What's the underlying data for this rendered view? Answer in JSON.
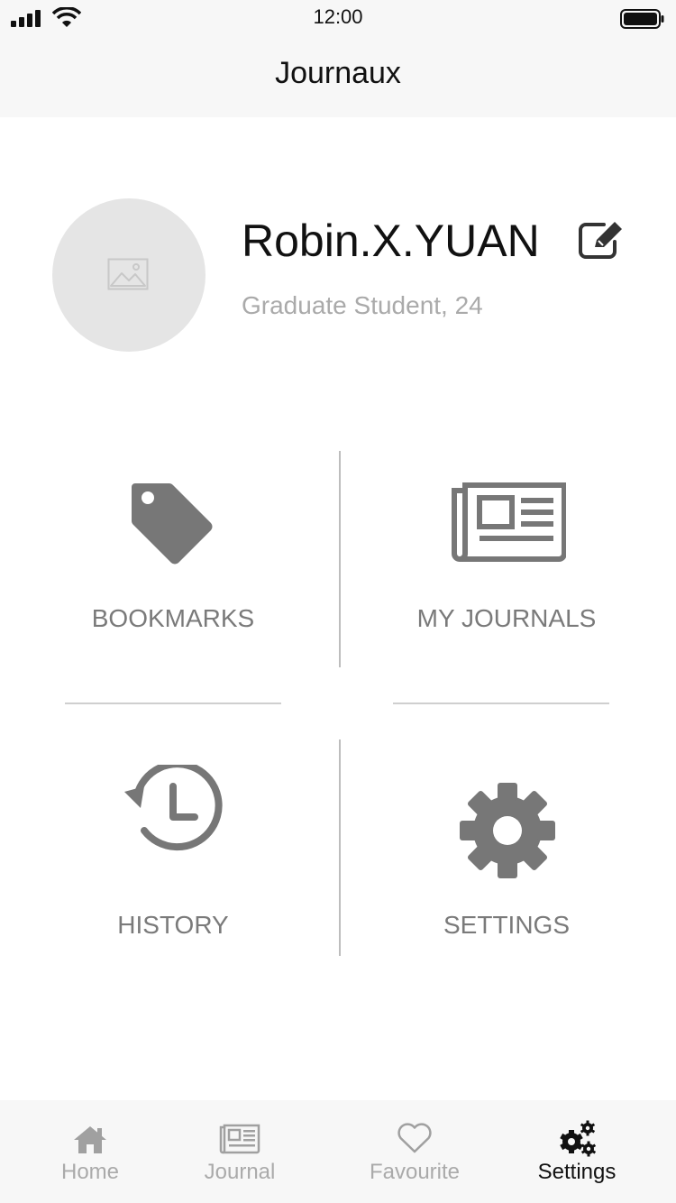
{
  "status_bar": {
    "time": "12:00"
  },
  "nav": {
    "title": "Journaux"
  },
  "profile": {
    "name": "Robin.X.YUAN",
    "subtitle": "Graduate Student, 24"
  },
  "menu": {
    "bookmarks": "BOOKMARKS",
    "my_journals": "MY JOURNALS",
    "history": "HISTORY",
    "settings": "SETTINGS"
  },
  "tabs": [
    {
      "label": "Home",
      "icon": "home-icon",
      "active": false
    },
    {
      "label": "Journal",
      "icon": "newspaper-icon",
      "active": false
    },
    {
      "label": "Favourite",
      "icon": "heart-icon",
      "active": false
    },
    {
      "label": "Settings",
      "icon": "gears-icon",
      "active": true
    }
  ],
  "colors": {
    "bar_background": "#f7f7f7",
    "icon_gray": "#777777",
    "label_gray": "#7a7a7a",
    "inactive_tab": "#aaaaaa",
    "active_tab": "#111111"
  }
}
